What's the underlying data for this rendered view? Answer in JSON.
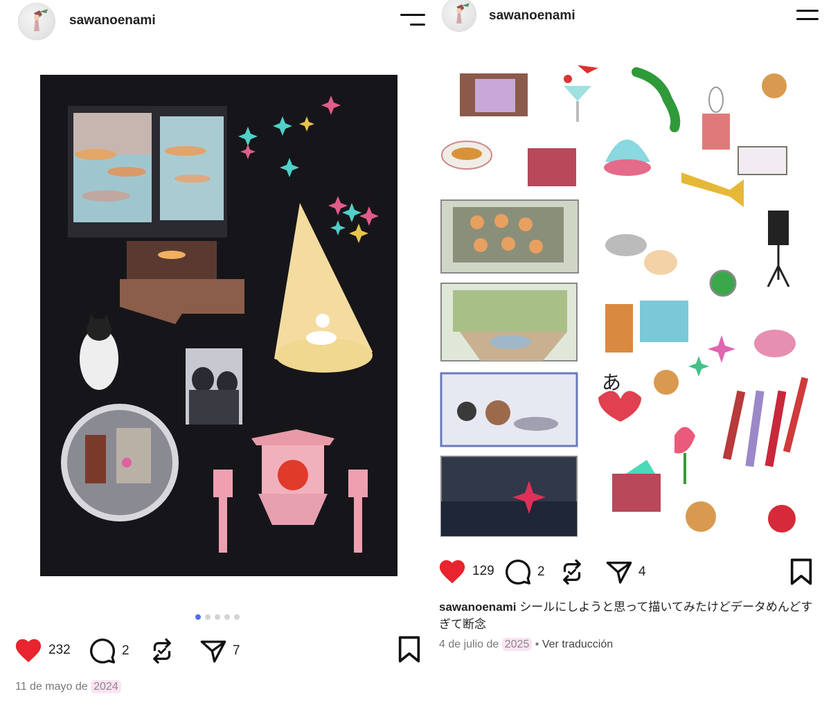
{
  "left_post": {
    "username": "sawanoenami",
    "likes": "232",
    "comments": "2",
    "reposts": "",
    "shares": "7",
    "date_prefix": "11 de mayo de",
    "date_year": "2024",
    "carousel": {
      "count": 5,
      "active": 1
    }
  },
  "right_post": {
    "username": "sawanoenami",
    "likes": "129",
    "comments": "2",
    "reposts": "",
    "shares": "4",
    "caption_user": "sawanoenami",
    "caption_text": "シールにしようと思って描いてみたけどデータめんどすぎて断念",
    "date_prefix": "4 de julio de",
    "date_year": "2025",
    "separator": "•",
    "translate_label": "Ver traducción"
  },
  "icons": {
    "avatar": "avatar-image",
    "menu": "menu-icon",
    "like": "heart-icon",
    "comment": "comment-icon",
    "repost": "repost-icon",
    "share": "send-icon",
    "bookmark": "bookmark-icon"
  },
  "colors": {
    "like": "#e8242e",
    "date_highlight": "#fbe3f2",
    "carousel_active": "#4a72e8",
    "artwork_bg": "#16161a"
  }
}
